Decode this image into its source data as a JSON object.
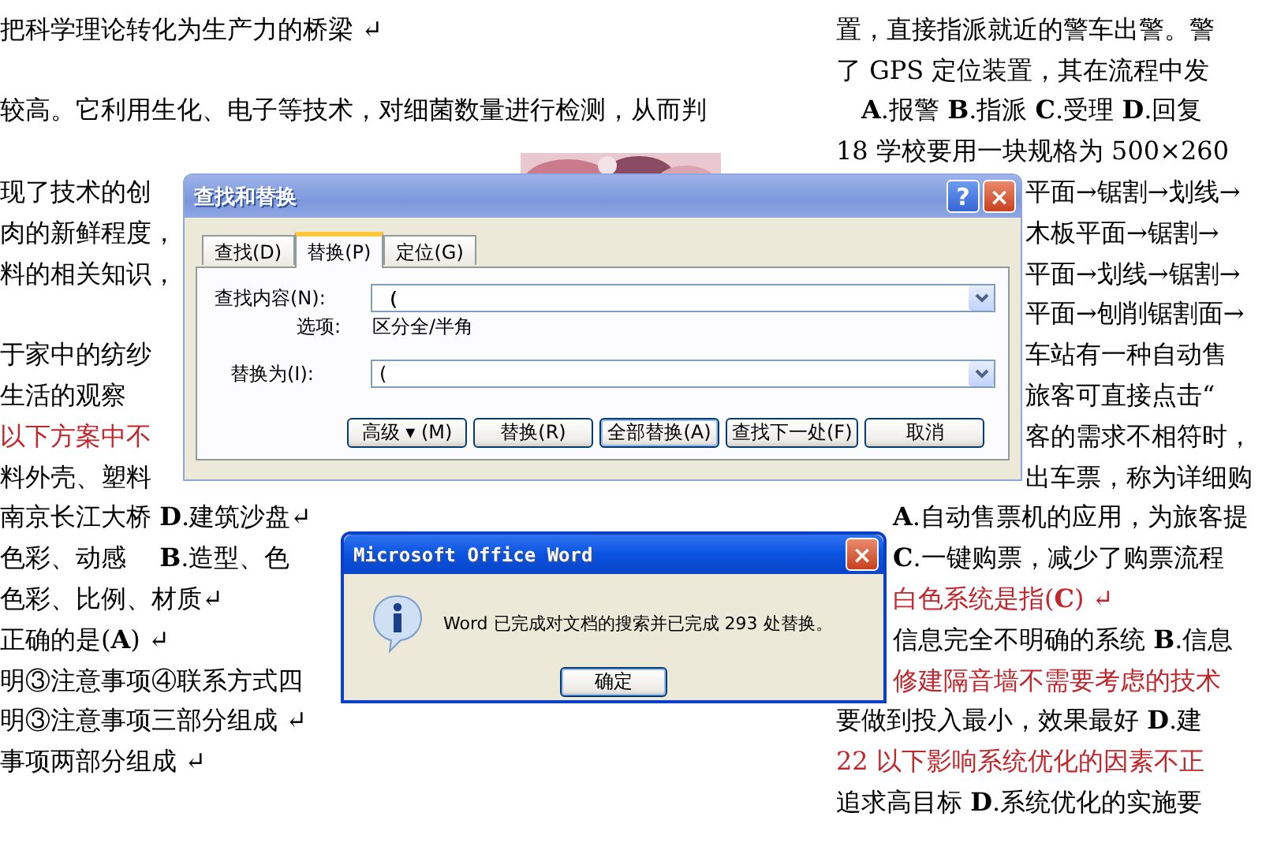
{
  "document": {
    "left_lines": [
      {
        "kind": "body",
        "text": "把科学理论转化为生产力的桥梁 ↵"
      },
      {
        "kind": "blank"
      },
      {
        "kind": "body",
        "text": "较高。它利用生化、电子等技术，对细菌数量进行检测，从而判"
      },
      {
        "kind": "blank"
      },
      {
        "kind": "body",
        "text": "现了技术的创"
      },
      {
        "kind": "body",
        "text": "肉的新鲜程度，"
      },
      {
        "kind": "body",
        "text": "料的相关知识，"
      },
      {
        "kind": "blank"
      },
      {
        "kind": "body",
        "text": "于家中的纺纱"
      },
      {
        "kind": "body",
        "text": "生活的观察"
      },
      {
        "kind": "question",
        "text": "以下方案中不"
      },
      {
        "kind": "body",
        "text": "料外壳、塑料"
      },
      {
        "kind": "body",
        "text": "南京长江大桥 **D**.建筑沙盘↵"
      },
      {
        "kind": "body",
        "text": "色彩、动感　 **B**.造型、色"
      },
      {
        "kind": "body",
        "text": "色彩、比例、材质↵"
      },
      {
        "kind": "body",
        "text": "正确的是(**A**) ↵"
      },
      {
        "kind": "body",
        "text": "明③注意事项④联系方式四"
      },
      {
        "kind": "body",
        "text": "明③注意事项三部分组成 ↵"
      },
      {
        "kind": "body",
        "text": "事项两部分组成 ↵"
      }
    ],
    "right_lines_top": [
      {
        "kind": "body",
        "text": "置，直接指派就近的警车出警。警"
      },
      {
        "kind": "body",
        "text": "了 GPS 定位装置，其在流程中发"
      },
      {
        "kind": "body",
        "text": "　**A**.报警 **B**.指派 **C**.受理 **D**.回复"
      },
      {
        "kind": "body",
        "text": "18 学校要用一块规格为 500×260"
      }
    ],
    "right_lines_beside_find_dialog": [
      {
        "kind": "body",
        "text": "平面→锯割→划线→"
      },
      {
        "kind": "body",
        "text": "木板平面→锯割→"
      },
      {
        "kind": "body",
        "text": "平面→划线→锯割→"
      },
      {
        "kind": "body",
        "text": "平面→刨削锯割面→"
      },
      {
        "kind": "body",
        "text": "车站有一种自动售"
      },
      {
        "kind": "body",
        "text": "旅客可直接点击“"
      },
      {
        "kind": "body",
        "text": "客的需求不相符时，"
      },
      {
        "kind": "body",
        "text": "出车票，称为详细购"
      }
    ],
    "right_lines_beside_message_dialog": [
      {
        "kind": "body",
        "text": "**A**.自动售票机的应用，为旅客提"
      },
      {
        "kind": "body",
        "text": "**C**.一键购票，减少了购票流程"
      },
      {
        "kind": "question",
        "text": "白色系统是指(**C**) ↵"
      },
      {
        "kind": "body",
        "text": "信息完全不明确的系统 **B**.信息"
      },
      {
        "kind": "question",
        "text": "修建隔音墙不需要考虑的技术"
      }
    ],
    "right_lines_bottom": [
      {
        "kind": "body",
        "text": "要做到投入最小，效果最好 **D**.建"
      },
      {
        "kind": "question",
        "text": "22 以下影响系统优化的因素不正"
      },
      {
        "kind": "body",
        "text": "追求高目标 **D**.系统优化的实施要"
      }
    ]
  },
  "find_dialog": {
    "title": "查找和替换",
    "help": "?",
    "close": "×",
    "tabs": [
      {
        "label": "查找(D)",
        "selected": false
      },
      {
        "label": "替换(P)",
        "selected": true
      },
      {
        "label": "定位(G)",
        "selected": false
      }
    ],
    "find_label": "查找内容(N):",
    "find_value": "（",
    "options_label": "选项:",
    "options_value": "区分全/半角",
    "replace_label": "替换为(I):",
    "replace_value": "(",
    "buttons": [
      {
        "label": "高级 ▾ (M)",
        "default": false
      },
      {
        "label": "替换(R)",
        "default": false
      },
      {
        "label": "全部替换(A)",
        "default": true
      },
      {
        "label": "查找下一处(F)",
        "default": false
      },
      {
        "label": "取消",
        "default": false
      }
    ]
  },
  "message_dialog": {
    "title": "Microsoft Office Word",
    "close": "×",
    "message": "Word 已完成对文档的搜索并已完成 293 处替换。",
    "ok": "确定"
  }
}
